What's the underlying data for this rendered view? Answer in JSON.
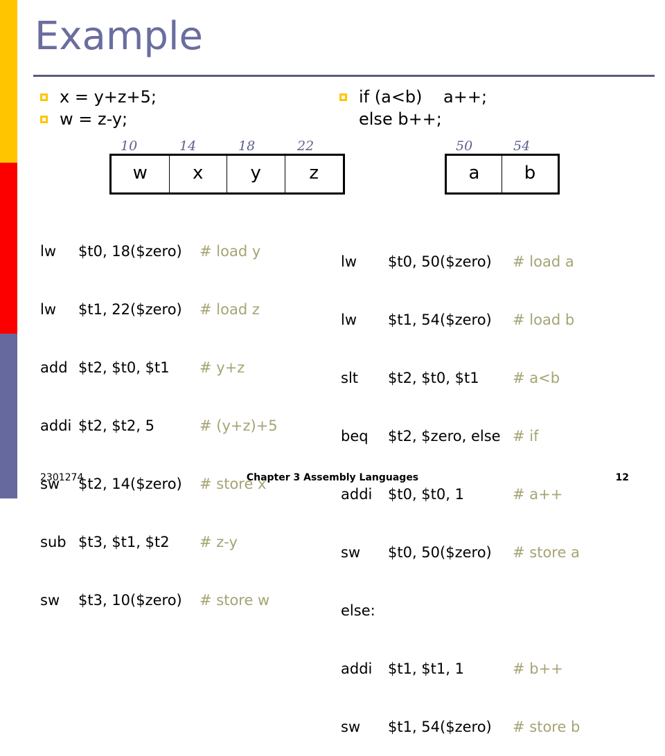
{
  "slide": {
    "title": "Example",
    "accent_colors": {
      "bar_yellow": "#ffc600",
      "bar_red": "#fc0000",
      "bar_purple": "#66699e",
      "title_text": "#6a6d9e",
      "rule": "#595a80",
      "address_label": "#5e608d",
      "comment": "#a5a473"
    }
  },
  "left_column": {
    "bullets": [
      {
        "marker": "square",
        "text": "x = y+z+5;"
      },
      {
        "marker": "square",
        "text": "w = z-y;"
      }
    ],
    "memory": {
      "addresses": [
        "10",
        "14",
        "18",
        "22"
      ],
      "cells": [
        "w",
        "x",
        "y",
        "z"
      ]
    },
    "code": [
      {
        "op": "lw",
        "args": "$t0, 18($zero)",
        "comment": "# load y"
      },
      {
        "op": "lw",
        "args": "$t1, 22($zero)",
        "comment": "# load z"
      },
      {
        "op": "add",
        "args": "$t2, $t0, $t1",
        "comment": "# y+z"
      },
      {
        "op": "addi",
        "args": "$t2, $t2, 5",
        "comment": "# (y+z)+5"
      },
      {
        "op": "sw",
        "args": "$t2, 14($zero)",
        "comment": "# store x"
      },
      {
        "op": "sub",
        "args": "$t3, $t1, $t2",
        "comment": "# z-y"
      },
      {
        "op": "sw",
        "args": "$t3, 10($zero)",
        "comment": "# store w"
      }
    ]
  },
  "right_column": {
    "bullets": [
      {
        "marker": "square",
        "text": "if (a<b)    a++;"
      },
      {
        "marker": "none",
        "text": "else b++;"
      }
    ],
    "memory": {
      "addresses": [
        "50",
        "54"
      ],
      "cells": [
        "a",
        "b"
      ]
    },
    "code": [
      {
        "op": "lw",
        "args": "$t0, 50($zero)",
        "comment": "# load a"
      },
      {
        "op": "lw",
        "args": "$t1, 54($zero)",
        "comment": "# load b"
      },
      {
        "op": "slt",
        "args": "$t2, $t0, $t1",
        "comment": "# a<b"
      },
      {
        "op": "beq",
        "args": "$t2, $zero, else",
        "comment": "# if"
      },
      {
        "op": "addi",
        "args": "$t0, $t0, 1",
        "comment": "# a++"
      },
      {
        "op": "sw",
        "args": "$t0, 50($zero)",
        "comment": "# store a"
      },
      {
        "op": "else:",
        "args": "",
        "comment": ""
      },
      {
        "op": "addi",
        "args": "$t1, $t1, 1",
        "comment": "# b++"
      },
      {
        "op": "sw",
        "args": "$t1, 54($zero)",
        "comment": "# store b"
      }
    ]
  },
  "footer": {
    "course_code": "2301274",
    "chapter": "Chapter 3 Assembly Languages",
    "page_number": "12"
  }
}
